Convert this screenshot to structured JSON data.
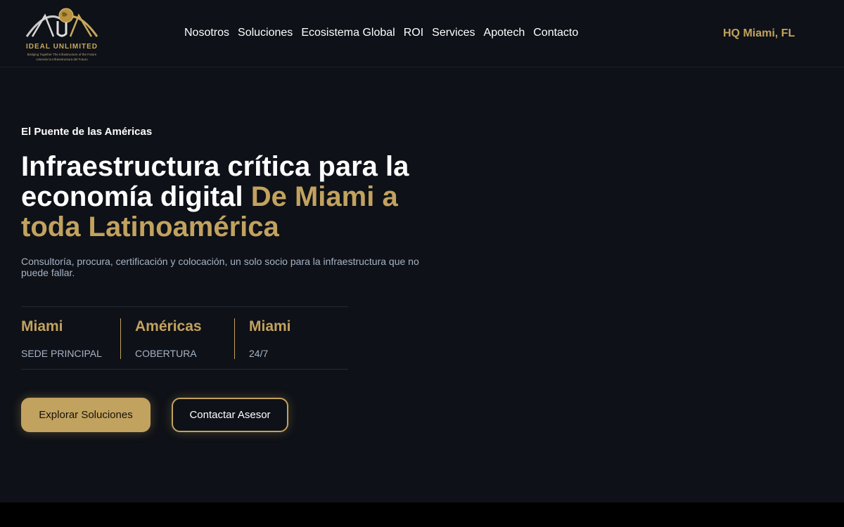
{
  "brand": {
    "name": "IDEAL UNLIMITED",
    "tagline_en": "Bridging Together The Infrastructure of the Future",
    "tagline_es": "Uniendo la Infraestructura del Futuro"
  },
  "nav": {
    "items": [
      {
        "label": "Nosotros"
      },
      {
        "label": "Soluciones"
      },
      {
        "label": "Ecosistema Global"
      },
      {
        "label": "ROI"
      },
      {
        "label": "Services"
      },
      {
        "label": "Apotech"
      },
      {
        "label": "Contacto"
      }
    ]
  },
  "header": {
    "location": "HQ Miami, FL"
  },
  "hero": {
    "eyebrow": "El Puente de las Américas",
    "headline_white": "Infraestructura crítica para la economía digital ",
    "headline_gold": "De Miami a toda Latinoamérica",
    "subtext": "Consultoría, procura, certificación y colocación, un solo socio para la infraestructura que no puede fallar.",
    "stats": [
      {
        "value": "Miami",
        "label": "SEDE PRINCIPAL"
      },
      {
        "value": "Américas",
        "label": "COBERTURA"
      },
      {
        "value": "Miami",
        "label": "24/7"
      }
    ],
    "primary_button": "Explorar Soluciones",
    "secondary_button": "Contactar Asesor"
  },
  "colors": {
    "background": "#0e1117",
    "accent_gold": "#c2a25f",
    "muted_text": "#a7b3c6"
  }
}
